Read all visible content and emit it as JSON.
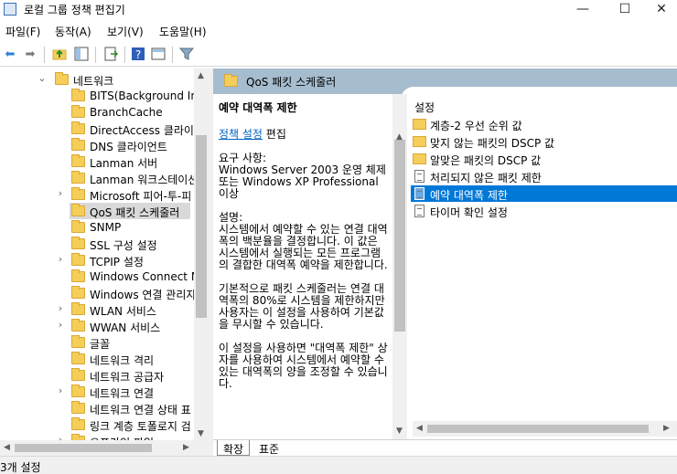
{
  "window": {
    "title": "로컬 그룹 정책 편집기",
    "minimize": "—",
    "maximize": "☐",
    "close": "✕"
  },
  "menu": [
    "파일(F)",
    "동작(A)",
    "보기(V)",
    "도움말(H)"
  ],
  "toolbar_icons": [
    "back-arrow",
    "forward-arrow",
    "up-folder",
    "show-hide-tree",
    "export-list",
    "help",
    "properties",
    "filter"
  ],
  "tree": {
    "items": [
      {
        "label": "네트워크",
        "expanded": true
      },
      {
        "label": "BITS(Background Inte"
      },
      {
        "label": "BranchCache"
      },
      {
        "label": "DirectAccess 클라이언"
      },
      {
        "label": "DNS 클라이언트"
      },
      {
        "label": "Lanman 서버"
      },
      {
        "label": "Lanman 워크스테이션"
      },
      {
        "label": "Microsoft 피어-투-피"
      },
      {
        "label": "QoS 패킷 스케줄러",
        "selected": true
      },
      {
        "label": "SNMP"
      },
      {
        "label": "SSL 구성 설정"
      },
      {
        "label": "TCPIP 설정"
      },
      {
        "label": "Windows Connect N"
      },
      {
        "label": "Windows 연결 관리자"
      },
      {
        "label": "WLAN 서비스"
      },
      {
        "label": "WWAN 서비스"
      },
      {
        "label": "글꼴"
      },
      {
        "label": "네트워크 격리"
      },
      {
        "label": "네트워크 공급자"
      },
      {
        "label": "네트워크 연결"
      },
      {
        "label": "네트워크 연결 상태 표"
      },
      {
        "label": "링크 계층 토폴로지 검"
      },
      {
        "label": "오프라인 파일"
      }
    ]
  },
  "banner": {
    "title": "QoS 패킷 스케줄러"
  },
  "description": {
    "title": "예약 대역폭 제한",
    "edit_link": "정책 설정",
    "edit_suffix": " 편집",
    "requirements_label": "요구 사항:",
    "requirements_text": "Windows Server 2003 운영 체제 또는 Windows XP Professional 이상",
    "desc_label": "설명:",
    "desc_p1": "시스템에서 예약할 수 있는 연결 대역폭의 백분율을 결정합니다. 이 값은 시스템에서 실행되는 모든 프로그램의 결합한 대역폭 예약을 제한합니다.",
    "desc_p2": "기본적으로 패킷 스케줄러는 연결 대역폭의 80%로 시스템을 제한하지만 사용자는 이 설정을 사용하여 기본값을 무시할 수 있습니다.",
    "desc_p3": "이 설정을 사용하면 \"대역폭 제한\" 상자를 사용하여 시스템에서 예약할 수 있는 대역폭의 양을 조정할 수 있습니다."
  },
  "settings": {
    "header": "설정",
    "items": [
      {
        "label": "계층-2 우선 순위 값",
        "kind": "folder"
      },
      {
        "label": "맞지 않는 패킷의 DSCP 값",
        "kind": "folder"
      },
      {
        "label": "알맞은 패킷의 DSCP 값",
        "kind": "folder"
      },
      {
        "label": "처리되지 않은 패킷 제한",
        "kind": "setting"
      },
      {
        "label": "예약 대역폭 제한",
        "kind": "setting",
        "selected": true
      },
      {
        "label": "타이머 확인 설정",
        "kind": "setting"
      }
    ]
  },
  "tabs": {
    "extended": "확장",
    "standard": "표준"
  },
  "status": {
    "text": "3개 설정"
  }
}
